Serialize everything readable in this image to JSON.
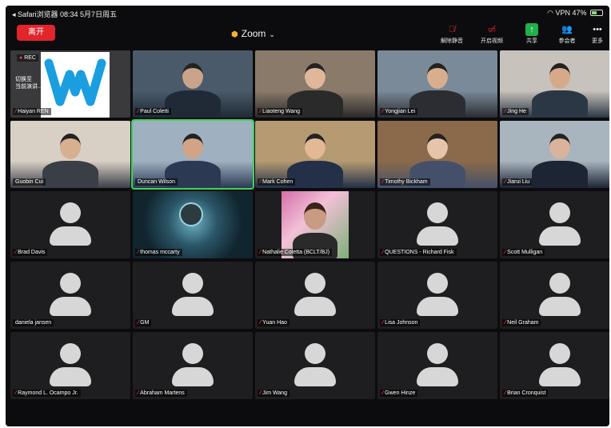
{
  "status_bar": {
    "left_text": "◂ Safari浏览器  08:34  5月7日周五",
    "wifi": "wifi-icon",
    "signal_label": "VPN",
    "battery_percent": "47%",
    "battery_level": 0.47
  },
  "toolbar": {
    "leave_label": "离开",
    "app_title": "Zoom",
    "buttons": [
      {
        "label": "解除静音",
        "icon": "mic-off-icon"
      },
      {
        "label": "开启视频",
        "icon": "video-off-icon"
      },
      {
        "label": "共享",
        "icon": "share-icon"
      },
      {
        "label": "参会者",
        "icon": "participants-icon"
      },
      {
        "label": "更多",
        "icon": "more-icon"
      }
    ]
  },
  "recording": {
    "label": "REC",
    "switch_tip": "切换至\n当前演讲..."
  },
  "participants": [
    {
      "name": "Haiyan REN",
      "muted": true,
      "type": "logo"
    },
    {
      "name": "Paul Coletti",
      "muted": true,
      "type": "video"
    },
    {
      "name": "Liaoteng Wang",
      "muted": true,
      "type": "video"
    },
    {
      "name": "Yongjian Lei",
      "muted": true,
      "type": "video"
    },
    {
      "name": "Jing He",
      "muted": true,
      "type": "video"
    },
    {
      "name": "Guobin Cui",
      "muted": false,
      "type": "video"
    },
    {
      "name": "Duncan Wilson",
      "muted": false,
      "type": "video",
      "active": true
    },
    {
      "name": "Mark Cohen",
      "muted": true,
      "type": "video"
    },
    {
      "name": "Timothy Bickham",
      "muted": true,
      "type": "video"
    },
    {
      "name": "Jiarui Liu",
      "muted": true,
      "type": "video"
    },
    {
      "name": "Brad Davis",
      "muted": true,
      "type": "avatar"
    },
    {
      "name": "thomas mccarty",
      "muted": true,
      "type": "image"
    },
    {
      "name": "Nathalie Coletta (BCLT/BJ)",
      "muted": true,
      "type": "photo"
    },
    {
      "name": "QUESTIONS - Richard Fisk",
      "muted": true,
      "type": "avatar"
    },
    {
      "name": "Scott Mulligan",
      "muted": true,
      "type": "avatar"
    },
    {
      "name": "daniela jansen",
      "muted": false,
      "type": "avatar"
    },
    {
      "name": "GM",
      "muted": true,
      "type": "avatar"
    },
    {
      "name": "Yuan Hao",
      "muted": true,
      "type": "avatar"
    },
    {
      "name": "Lisa Johnson",
      "muted": true,
      "type": "avatar"
    },
    {
      "name": "Neil Graham",
      "muted": true,
      "type": "avatar"
    },
    {
      "name": "Raymond L. Ocampo Jr.",
      "muted": true,
      "type": "avatar"
    },
    {
      "name": "Abraham Martens",
      "muted": true,
      "type": "avatar"
    },
    {
      "name": "Jim Wang",
      "muted": true,
      "type": "avatar"
    },
    {
      "name": "Gwen Hinze",
      "muted": true,
      "type": "avatar"
    },
    {
      "name": "Brian Cronquist",
      "muted": true,
      "type": "avatar"
    }
  ],
  "colors": {
    "leave_button": "#e0252b",
    "share_button": "#21b14a",
    "active_speaker_border": "#3ad55c",
    "muted_mic": "#ff3b3b"
  }
}
